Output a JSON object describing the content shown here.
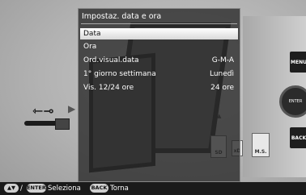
{
  "menu": {
    "title": "Impostaz. data e ora",
    "items": [
      {
        "label": "Data",
        "value": ""
      },
      {
        "label": "Ora",
        "value": ""
      },
      {
        "label": "Ord.visual.data",
        "value": "G-M-A"
      },
      {
        "label": "1° giorno settimana",
        "value": "Lunedì"
      },
      {
        "label": "Vis. 12/24 ore",
        "value": "24 ore"
      }
    ]
  },
  "device": {
    "menu_button": "MENU",
    "enter_button": "ENTER",
    "back_button": "BACK",
    "card_sd": "SD",
    "card_xd": "xD",
    "card_ms": "M.S."
  },
  "bottom_bar": {
    "enter_key": "ENTER",
    "select_label": "Seleziona",
    "back_key": "BACK",
    "back_label": "Torna",
    "nav_icon": "up-down-arrows-icon"
  }
}
